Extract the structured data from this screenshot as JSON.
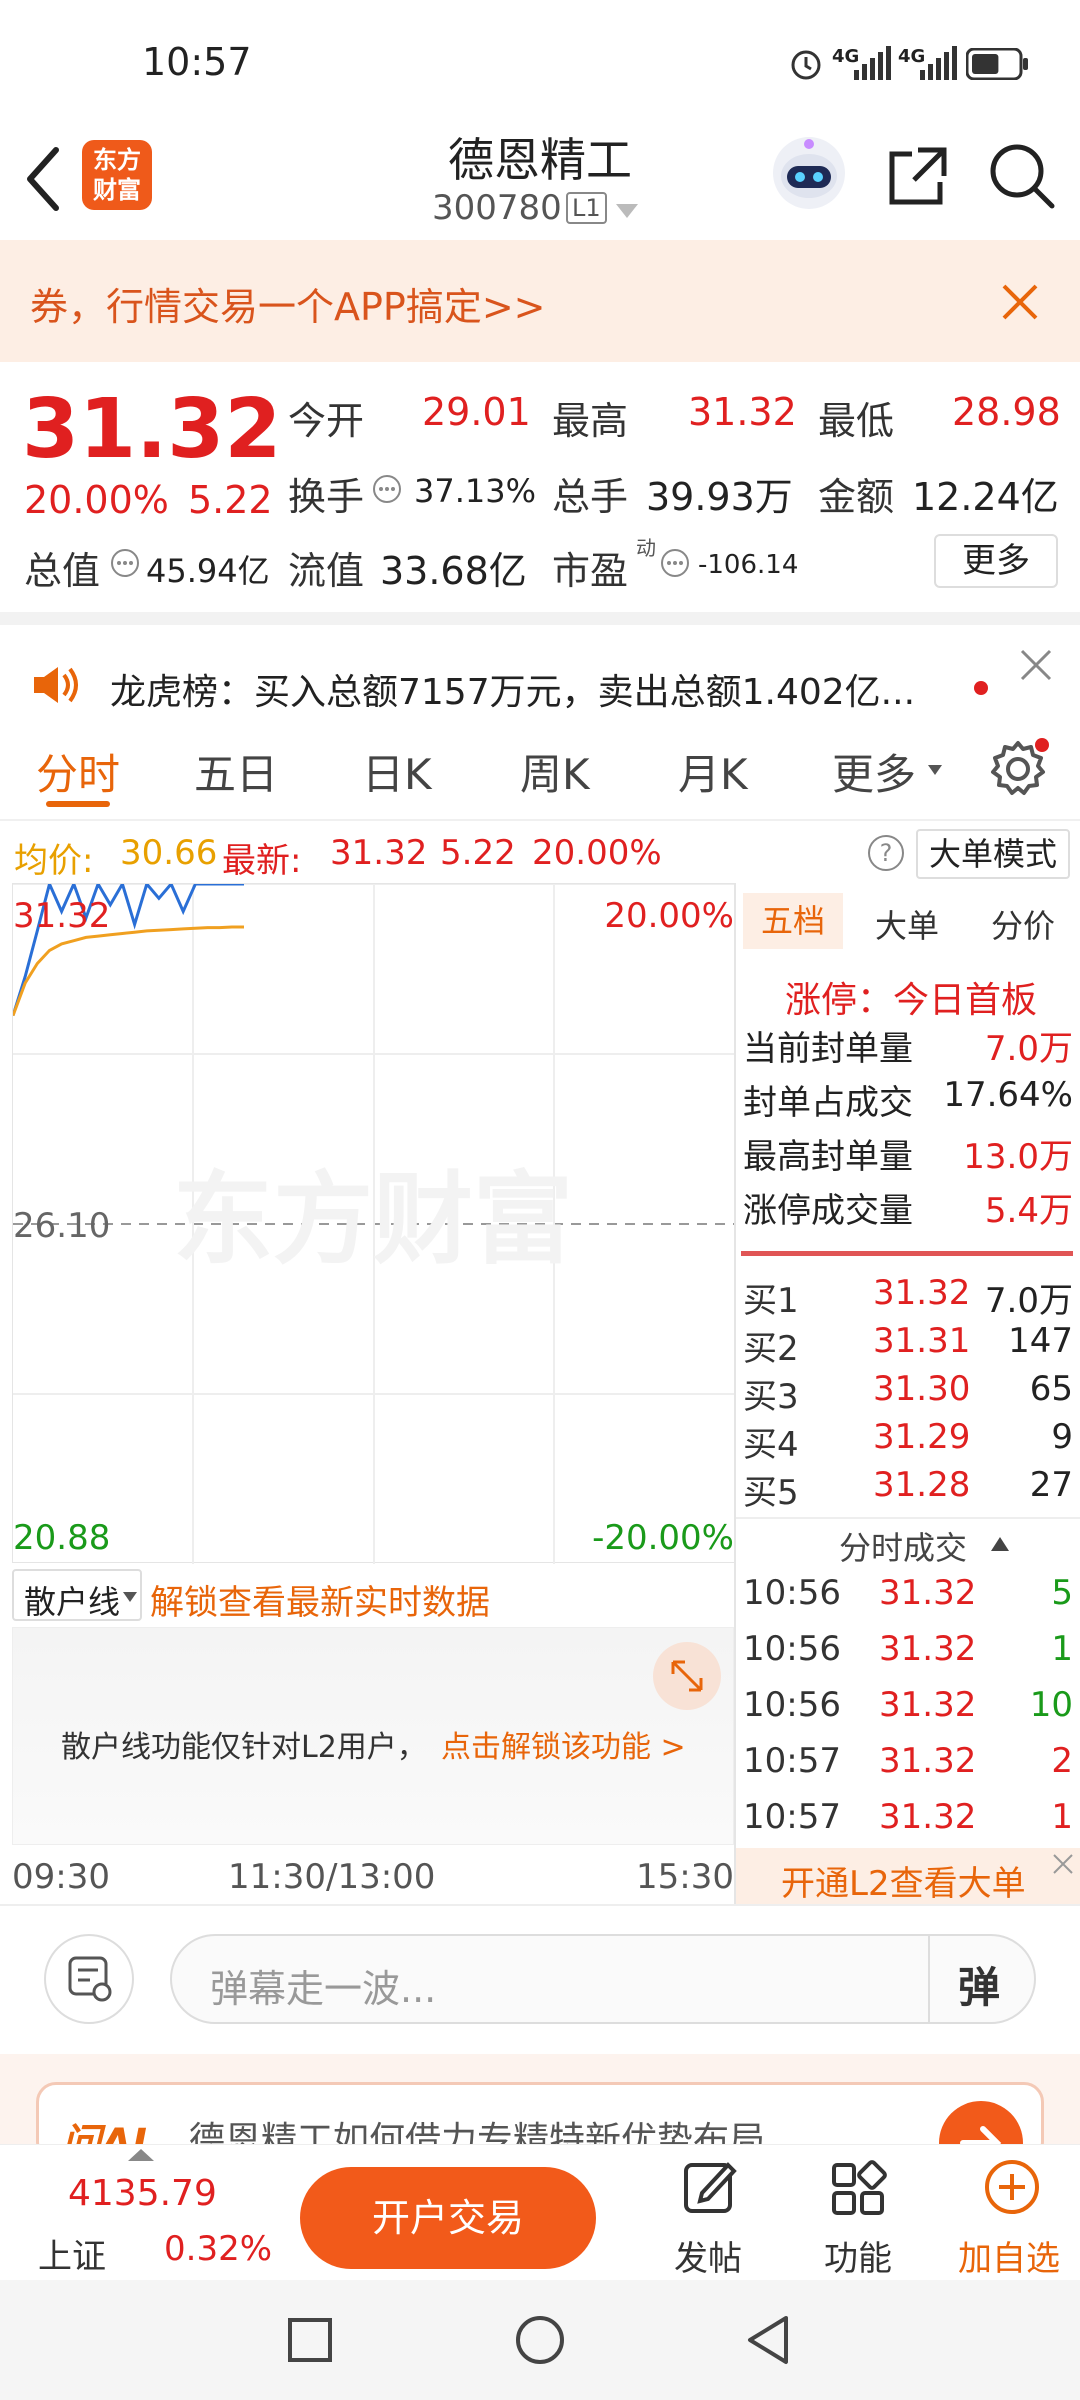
{
  "status": {
    "time": "10:57",
    "signal1": "4G",
    "signal2": "4G",
    "battery_level": 0.6
  },
  "header": {
    "brand_line1": "东方",
    "brand_line2": "财富",
    "stock_name": "德恩精工",
    "stock_code": "300780",
    "level_badge": "L1"
  },
  "banner": {
    "text": "券，行情交易一个APP搞定>>"
  },
  "quote": {
    "price": "31.32",
    "change_pct": "20.00%",
    "change_amt": "5.22",
    "open_label": "今开",
    "open": "29.01",
    "high_label": "最高",
    "high": "31.32",
    "low_label": "最低",
    "low": "28.98",
    "turnover_label": "换手",
    "turnover": "37.13%",
    "volume_label": "总手",
    "volume": "39.93万",
    "amount_label": "金额",
    "amount": "12.24亿",
    "mcap_label": "总值",
    "mcap": "45.94亿",
    "float_label": "流值",
    "float_val": "33.68亿",
    "pe_label": "市盈",
    "pe_sup": "动",
    "pe": "-106.14",
    "more": "更多"
  },
  "notice": {
    "text": "龙虎榜：买入总额7157万元，卖出总额1.402亿..."
  },
  "tabs": {
    "items": [
      "分时",
      "五日",
      "日K",
      "周K",
      "月K",
      "更多"
    ],
    "active": 0
  },
  "chart_info": {
    "avg_label": "均价:",
    "avg": "30.66",
    "last_label": "最新:",
    "last": "31.32",
    "chg": "5.22",
    "pct": "20.00%",
    "mode_btn": "大单模式",
    "help": "?"
  },
  "chart_data": {
    "type": "line",
    "top_label": "31.32",
    "top_pct": "20.00%",
    "mid_label": "26.10",
    "bottom_label": "20.88",
    "bottom_pct": "-20.00%",
    "watermark": "东方财富",
    "ylim": [
      20.88,
      31.32
    ],
    "series": [
      {
        "values": [
          29.3,
          29.9,
          30.6,
          31.32,
          30.9,
          31.32,
          30.8,
          31.32,
          31.0,
          31.32,
          30.7,
          31.32,
          31.1,
          31.32,
          30.9,
          31.32,
          31.32,
          31.32,
          31.32,
          31.32
        ]
      },
      {
        "values": [
          29.3,
          29.8,
          30.1,
          30.3,
          30.4,
          30.45,
          30.5,
          30.52,
          30.54,
          30.56,
          30.58,
          30.6,
          30.61,
          30.62,
          30.63,
          30.64,
          30.65,
          30.65,
          30.66,
          30.66
        ]
      }
    ],
    "x_ticks": [
      "09:30",
      "11:30/13:00",
      "15:30"
    ]
  },
  "right_panel": {
    "tabs": [
      "五档",
      "大单",
      "分价"
    ],
    "limit_status": "涨停：今日首板",
    "stats": [
      {
        "label": "当前封单量",
        "value": "7.0万"
      },
      {
        "label": "封单占成交",
        "value": "17.64%"
      },
      {
        "label": "最高封单量",
        "value": "13.0万"
      },
      {
        "label": "涨停成交量",
        "value": "5.4万"
      }
    ],
    "orderbook": [
      {
        "label": "买1",
        "price": "31.32",
        "vol": "7.0万"
      },
      {
        "label": "买2",
        "price": "31.31",
        "vol": "147"
      },
      {
        "label": "买3",
        "price": "31.30",
        "vol": "65"
      },
      {
        "label": "买4",
        "price": "31.29",
        "vol": "9"
      },
      {
        "label": "买5",
        "price": "31.28",
        "vol": "27"
      }
    ],
    "ticks_title": "分时成交",
    "ticks": [
      {
        "time": "10:56",
        "price": "31.32",
        "vol": "5",
        "color": "#1a9a1a"
      },
      {
        "time": "10:56",
        "price": "31.32",
        "vol": "1",
        "color": "#1a9a1a"
      },
      {
        "time": "10:56",
        "price": "31.32",
        "vol": "10",
        "color": "#1a9a1a"
      },
      {
        "time": "10:57",
        "price": "31.32",
        "vol": "2",
        "color": "#e02020"
      },
      {
        "time": "10:57",
        "price": "31.32",
        "vol": "1",
        "color": "#e02020"
      }
    ],
    "l2_promo": "开通L2查看大单"
  },
  "sanhu": {
    "selector": "散户线",
    "unlock": "解锁查看最新实时数据",
    "info": "散户线功能仅针对L2用户，",
    "link": "点击解锁该功能 >"
  },
  "danmu": {
    "placeholder": "弹幕走一波...",
    "btn": "弹"
  },
  "ai_card": {
    "brand": "问AI",
    "text": "德恩精工如何借力专精特新优势布局"
  },
  "bottom_nav": {
    "index_value": "4135.79",
    "index_name": "上证",
    "index_pct": "0.32%",
    "trade_btn": "开户交易",
    "post": "发帖",
    "func": "功能",
    "add": "加自选"
  }
}
